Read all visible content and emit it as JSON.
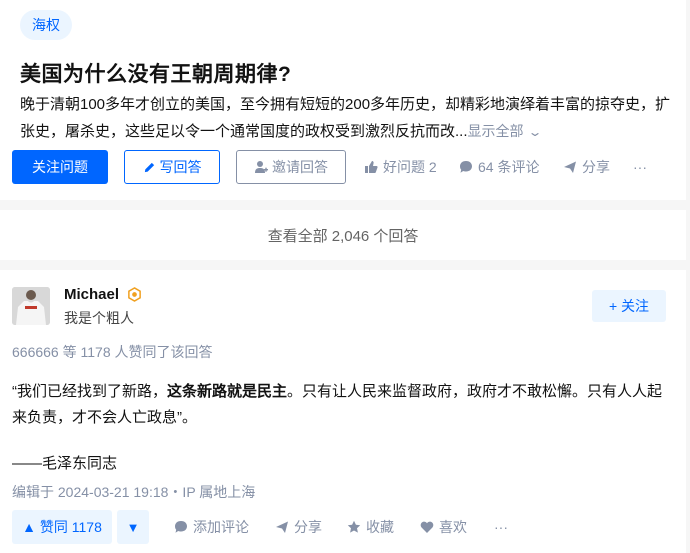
{
  "question": {
    "topic": "海权",
    "title": "美国为什么没有王朝周期律?",
    "excerpt": "晚于清朝100多年才创立的美国，至今拥有短短的200多年历史，却精彩地演绎着丰富的掠夺史，扩张史，屠杀史，这些足以令一个通常国度的政权受到激烈反抗而改...",
    "show_all": "显示全部",
    "follow_label": "关注问题",
    "answer_label": "写回答",
    "invite_label": "邀请回答",
    "good_question_label": "好问题 2",
    "comments_label": "64 条评论",
    "share_label": "分享",
    "more_label": "···"
  },
  "view_all": "查看全部 2,046 个回答",
  "answer": {
    "author_name": "Michael",
    "author_bio": "我是个粗人",
    "follow_label": "+ 关注",
    "voters_text": "666666 等 1178 人赞同了该回答",
    "body_pre": "“我们已经找到了新路，",
    "body_bold": "这条新路就是民主",
    "body_post": "。只有让人民来监督政府，政府才不敢松懈。只有人人起来负责，才不会人亡政息”。",
    "signature": "——毛泽东同志",
    "meta": "编辑于 2024-03-21 19:18・IP 属地上海",
    "upvote_label": "▲ 赞同 1178",
    "downvote_label": "▼",
    "comment_label": "添加评论",
    "share_label": "分享",
    "collect_label": "收藏",
    "like_label": "喜欢",
    "more_label": "···"
  },
  "colors": {
    "accent": "#0066ff",
    "accent_light": "#ebf5ff",
    "muted": "#8590a6"
  }
}
